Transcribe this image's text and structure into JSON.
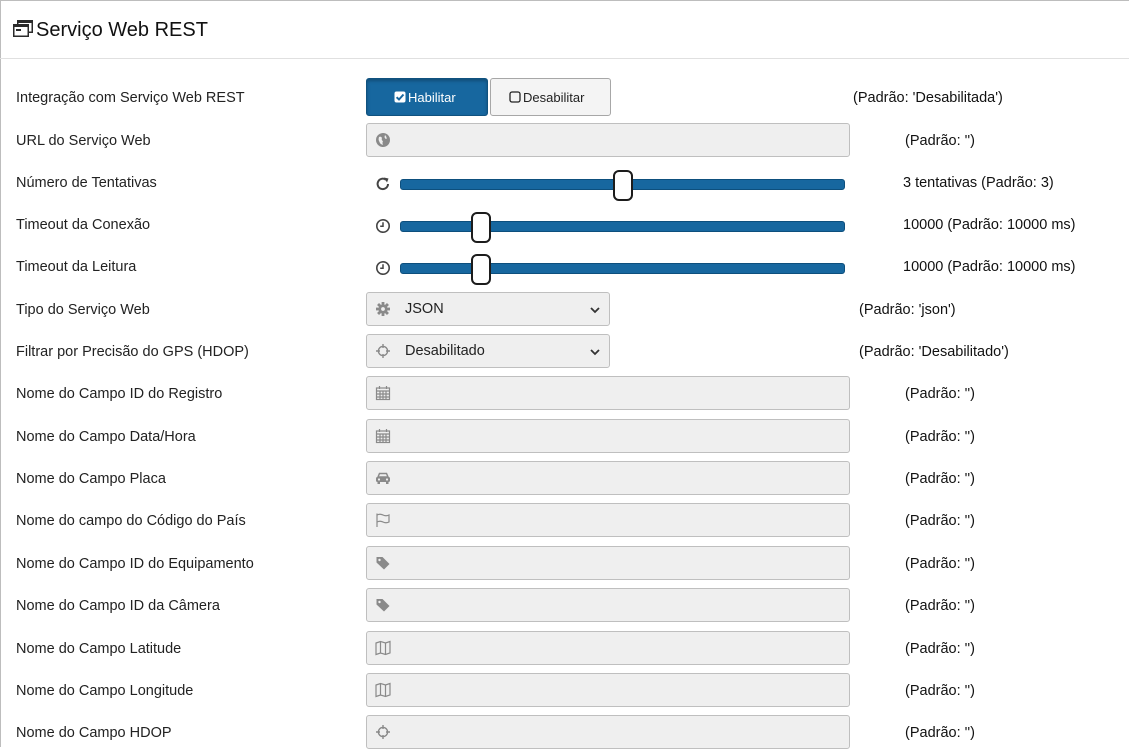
{
  "header": {
    "title": "Serviço Web REST",
    "icon": "window-stack-icon"
  },
  "rows": {
    "integracao": {
      "label": "Integração com Serviço Web REST",
      "enable_label": "Habilitar",
      "disable_label": "Desabilitar",
      "selected": "Habilitar",
      "default": "(Padrão: 'Desabilitada')"
    },
    "url": {
      "label": "URL do Serviço Web",
      "value": "",
      "icon": "globe-icon",
      "default": "(Padrão: '')"
    },
    "tentativas": {
      "label": "Número de Tentativas",
      "value": 3,
      "min": 1,
      "max": 5,
      "icon": "refresh-icon",
      "display": "3 tentativas  (Padrão: 3)"
    },
    "timeout_conexao": {
      "label": "Timeout da Conexão",
      "value": 10000,
      "min": 0,
      "max": 60000,
      "icon": "clock-icon",
      "display": "10000  (Padrão: 10000 ms)"
    },
    "timeout_leitura": {
      "label": "Timeout da Leitura",
      "value": 10000,
      "min": 0,
      "max": 60000,
      "icon": "clock-icon",
      "display": "10000  (Padrão: 10000 ms)"
    },
    "tipo": {
      "label": "Tipo do Serviço Web",
      "value": "JSON",
      "icon": "gear-icon",
      "default": "(Padrão: 'json')"
    },
    "hdop_filtro": {
      "label": "Filtrar por Precisão do GPS (HDOP)",
      "value": "Desabilitado",
      "icon": "crosshair-icon",
      "default": "(Padrão: 'Desabilitado')"
    },
    "campo_id_registro": {
      "label": "Nome do Campo ID do Registro",
      "value": "",
      "icon": "calendar-icon",
      "default": "(Padrão: '')"
    },
    "campo_data_hora": {
      "label": "Nome do Campo Data/Hora",
      "value": "",
      "icon": "calendar-icon",
      "default": "(Padrão: '')"
    },
    "campo_placa": {
      "label": "Nome do Campo Placa",
      "value": "",
      "icon": "car-icon",
      "default": "(Padrão: '')"
    },
    "campo_pais": {
      "label": "Nome do campo do Código do País",
      "value": "",
      "icon": "flag-icon",
      "default": "(Padrão: '')"
    },
    "campo_equipamento": {
      "label": "Nome do Campo ID do Equipamento",
      "value": "",
      "icon": "tag-icon",
      "default": "(Padrão: '')"
    },
    "campo_camera": {
      "label": "Nome do Campo ID da Câmera",
      "value": "",
      "icon": "tag-icon",
      "default": "(Padrão: '')"
    },
    "campo_latitude": {
      "label": "Nome do Campo Latitude",
      "value": "",
      "icon": "map-icon",
      "default": "(Padrão: '')"
    },
    "campo_longitude": {
      "label": "Nome do Campo Longitude",
      "value": "",
      "icon": "map-icon",
      "default": "(Padrão: '')"
    },
    "campo_hdop": {
      "label": "Nome do Campo HDOP",
      "value": "",
      "icon": "crosshair-icon",
      "default": "(Padrão: '')"
    }
  },
  "colors": {
    "primary": "#17679f",
    "field_bg": "#efefef",
    "icon_grey": "#8a8a8a"
  }
}
